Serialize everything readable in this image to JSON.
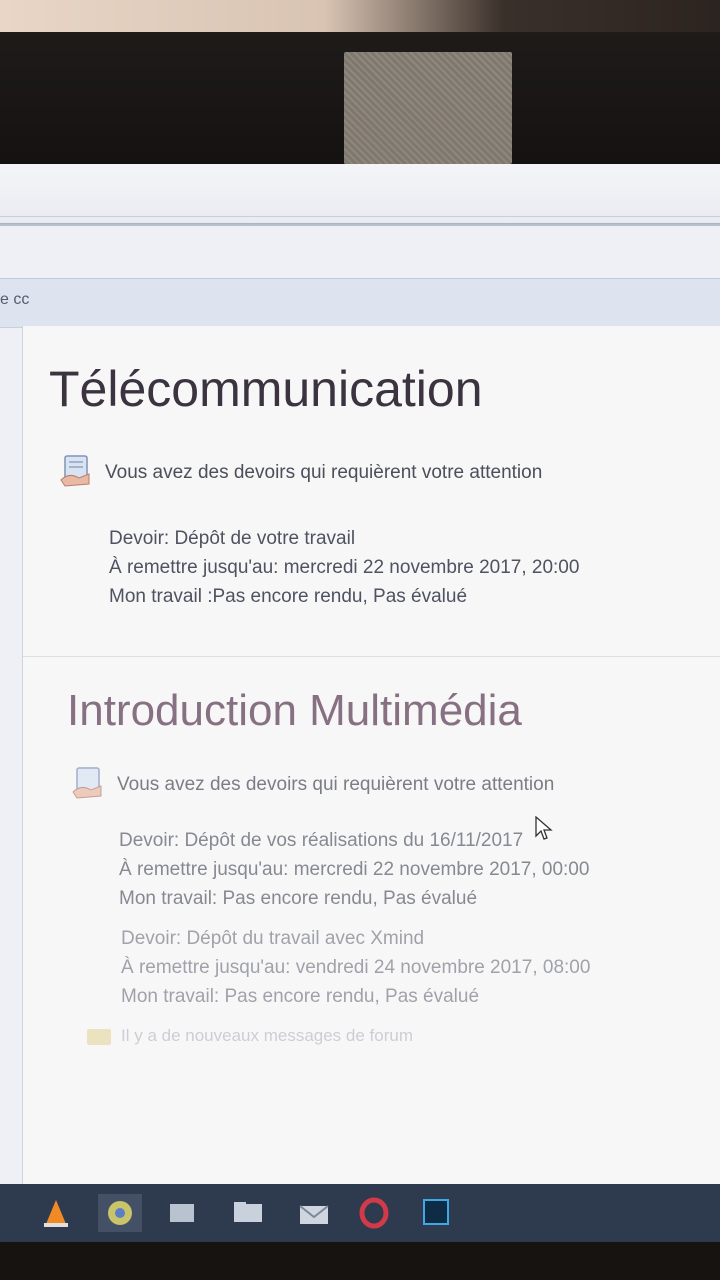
{
  "browser": {
    "nav_text": "e cc"
  },
  "courses": [
    {
      "title": "Télécommunication",
      "alert": "Vous avez des devoirs qui requièrent votre attention",
      "assignments": [
        {
          "devoir": "Devoir: Dépôt de votre travail",
          "due": "À remettre jusqu'au: mercredi 22 novembre 2017, 20:00",
          "status": "Mon travail :Pas encore rendu, Pas évalué"
        }
      ]
    },
    {
      "title": "Introduction Multimédia",
      "alert": "Vous avez des devoirs qui requièrent votre attention",
      "assignments": [
        {
          "devoir": "Devoir: Dépôt de vos réalisations du 16/11/2017",
          "due": "À remettre jusqu'au: mercredi 22 novembre 2017, 00:00",
          "status": "Mon travail: Pas encore rendu, Pas évalué"
        },
        {
          "devoir": "Devoir: Dépôt du travail avec Xmind",
          "due": "À remettre jusqu'au: vendredi 24 novembre 2017, 08:00",
          "status": "Mon travail: Pas encore rendu, Pas évalué"
        }
      ],
      "forum": "Il y a de nouveaux messages de forum"
    }
  ],
  "taskbar": {
    "icons": [
      "vlc-icon",
      "chrome-icon",
      "app-icon",
      "file-explorer-icon",
      "mail-icon",
      "opera-icon",
      "photoshop-icon"
    ]
  }
}
